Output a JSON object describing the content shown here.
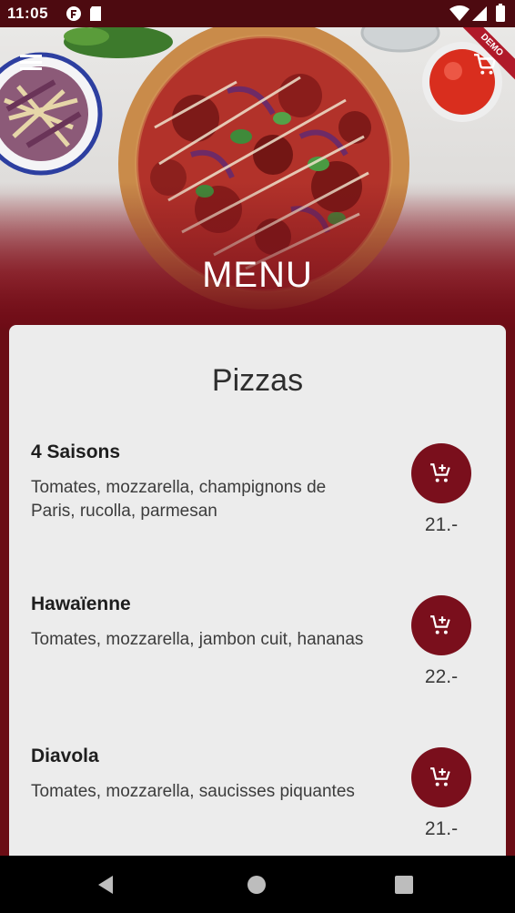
{
  "status_bar": {
    "time": "11:05"
  },
  "header": {
    "title": "MENU",
    "ribbon": "DEMO"
  },
  "section": {
    "title": "Pizzas"
  },
  "items": [
    {
      "name": "4 Saisons",
      "description": "Tomates, mozzarella, champignons de Paris, rucolla, parmesan",
      "price": "21.-"
    },
    {
      "name": "Hawaïenne",
      "description": "Tomates, mozzarella, jambon cuit, hananas",
      "price": "22.-"
    },
    {
      "name": "Diavola",
      "description": "Tomates, mozzarella, saucisses piquantes",
      "price": "21.-"
    }
  ],
  "icons": {
    "menu": "hamburger-icon",
    "cart": "cart-icon",
    "add_to_cart": "add-to-cart-icon",
    "back": "back-icon",
    "home": "home-icon",
    "recents": "recents-icon"
  },
  "colors": {
    "accent": "#7a0f1c",
    "background": "#6b0d15",
    "card": "#ececec"
  }
}
